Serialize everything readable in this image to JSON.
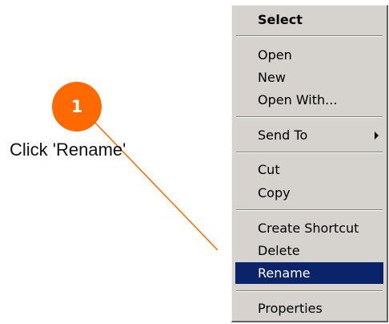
{
  "annotation": {
    "step_number": "1",
    "instruction": "Click 'Rename'",
    "badge_color": "#ff6a00",
    "line_color": "#ff6a00"
  },
  "context_menu": {
    "highlight_color": "#0a246a",
    "items": [
      {
        "label": "Select",
        "bold": true
      },
      {
        "label": "Open"
      },
      {
        "label": "New"
      },
      {
        "label": "Open With..."
      },
      {
        "label": "Send To",
        "submenu": true
      },
      {
        "label": "Cut"
      },
      {
        "label": "Copy"
      },
      {
        "label": "Create Shortcut"
      },
      {
        "label": "Delete"
      },
      {
        "label": "Rename",
        "selected": true
      },
      {
        "label": "Properties"
      }
    ]
  }
}
